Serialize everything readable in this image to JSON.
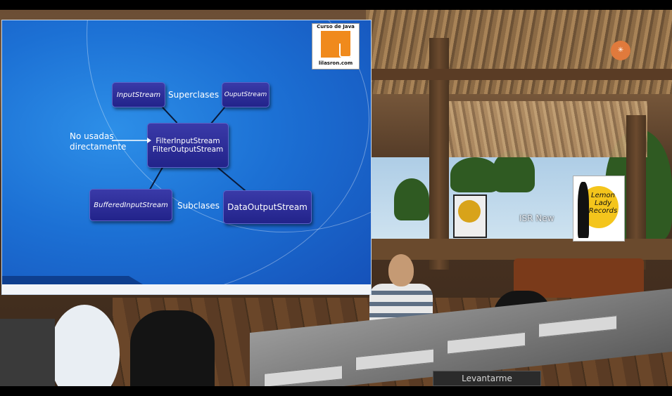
{
  "slide": {
    "logo": {
      "top_text": "Curso de Java",
      "bottom_text": "lilasron.com"
    },
    "nodes": {
      "inputstream": "InputStream",
      "ouputstream": "OuputStream",
      "filter_line1": "FilterInputStream",
      "filter_line2": "FilterOutputStream",
      "buffered": "BufferedInputStream",
      "dataoutput": "DataOutputStream"
    },
    "labels": {
      "superclases": "Superclases",
      "subclases": "Subclases",
      "no_usadas_line1": "No usadas",
      "no_usadas_line2": "directamente"
    }
  },
  "world": {
    "name_tag": "ISR New",
    "sign_text": "Lemon Lady Records",
    "ubuntu_icon": "ubuntu-logo",
    "stand_button": "Levantarme"
  },
  "colors": {
    "slide_blue": "#1c70d4",
    "node_navy": "#22238a",
    "logo_orange": "#f08a1c"
  }
}
